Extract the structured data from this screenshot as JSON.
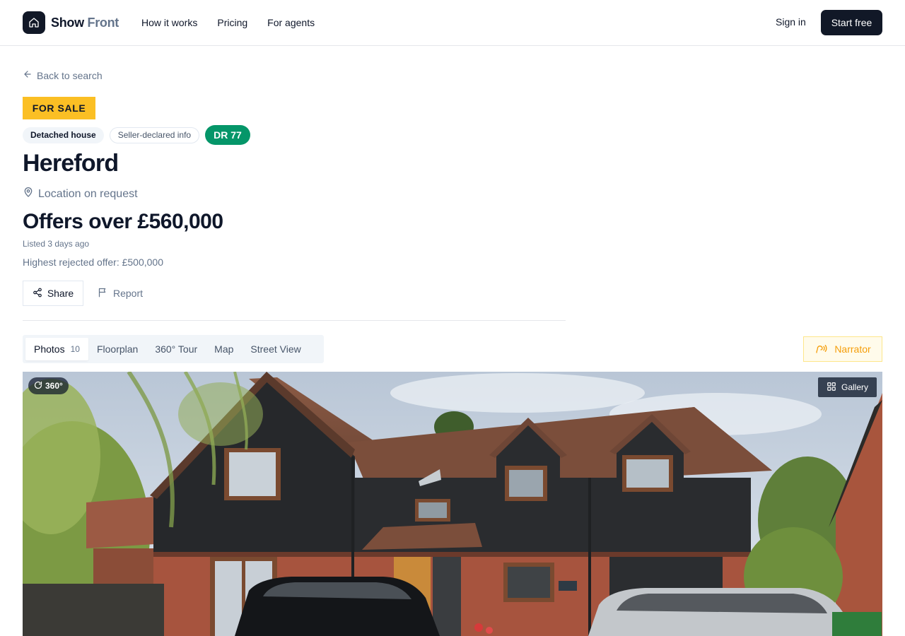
{
  "header": {
    "brand_main": "Show",
    "brand_accent": "Front",
    "nav": [
      "How it works",
      "Pricing",
      "For agents"
    ],
    "signin_label": "Sign in",
    "start_label": "Start free"
  },
  "listing": {
    "back_label": "Back to search",
    "status_tag": "FOR SALE",
    "chips": {
      "type": "Detached house",
      "info": "Seller-declared info",
      "rating": "DR 77"
    },
    "title": "Hereford",
    "location": "Location on request",
    "price": "Offers over £560,000",
    "listed": "Listed 3 days ago",
    "highest_rejected": "Highest rejected offer: £500,000",
    "share_label": "Share",
    "report_label": "Report"
  },
  "media": {
    "tabs": [
      {
        "label": "Photos",
        "count": "10"
      },
      {
        "label": "Floorplan"
      },
      {
        "label": "360° Tour"
      },
      {
        "label": "Map"
      },
      {
        "label": "Street View"
      }
    ],
    "narrator_label": "Narrator",
    "badge_360": "360°",
    "gallery_label": "Gallery"
  },
  "colors": {
    "brand_dark": "#111827",
    "for_sale": "#fbbf24",
    "rating_badge": "#059669",
    "narrator_accent": "#f59e0b"
  }
}
